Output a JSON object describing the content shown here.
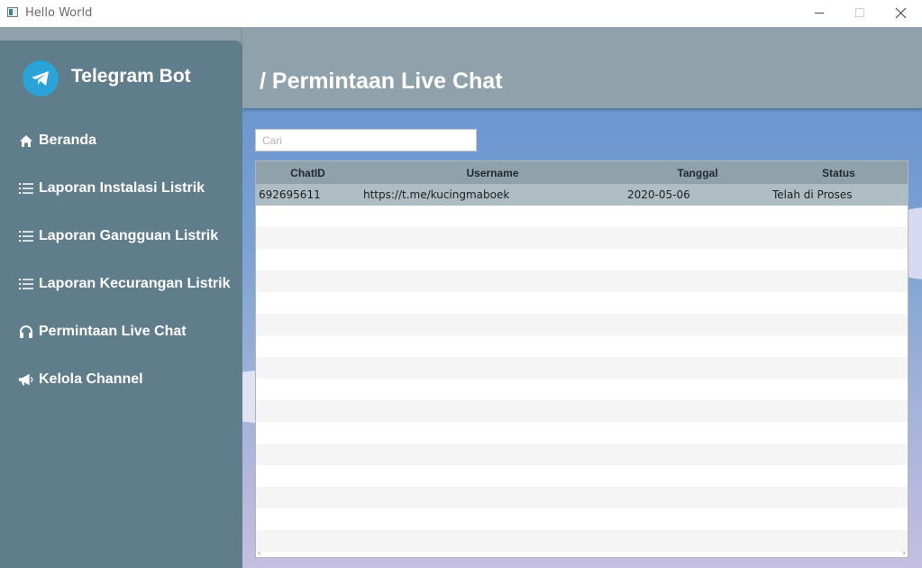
{
  "window": {
    "title": "Hello World"
  },
  "sidebar": {
    "brand": "Telegram Bot",
    "items": [
      {
        "label": "Beranda",
        "icon": "home-icon"
      },
      {
        "label": "Laporan Instalasi Listrik",
        "icon": "list-icon"
      },
      {
        "label": "Laporan Gangguan Listrik",
        "icon": "list-icon"
      },
      {
        "label": "Laporan Kecurangan Listrik",
        "icon": "list-icon"
      },
      {
        "label": "Permintaan Live Chat",
        "icon": "headphones-icon"
      },
      {
        "label": "Kelola Channel",
        "icon": "bullhorn-icon"
      }
    ]
  },
  "header": {
    "title": "/ Permintaan Live Chat"
  },
  "search": {
    "placeholder": "Cari",
    "value": ""
  },
  "table": {
    "columns": [
      "ChatID",
      "Username",
      "Tanggal",
      "Status"
    ],
    "rows": [
      {
        "chatid": "692695611",
        "username": "https://t.me/kucingmaboek",
        "tanggal": "2020-05-06",
        "status": "Telah di Proses"
      }
    ]
  },
  "colors": {
    "sidebar": "#607d8b",
    "header": "#8fa1aa",
    "selected_row": "#aebdc4",
    "telegram_blue": "#2aa3d8"
  }
}
